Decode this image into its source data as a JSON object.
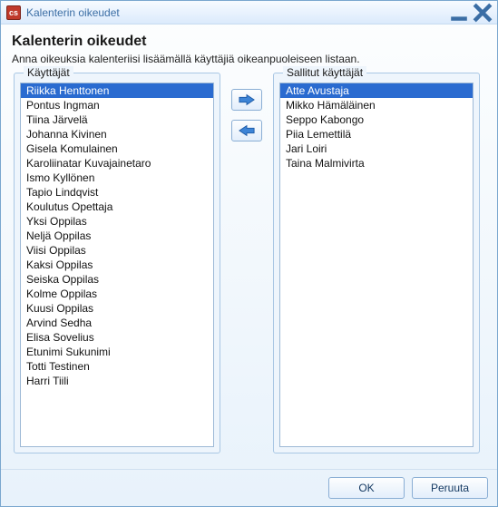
{
  "window": {
    "title": "Kalenterin oikeudet"
  },
  "dialog": {
    "title": "Kalenterin oikeudet",
    "subtitle": "Anna oikeuksia kalenteriisi lisäämällä käyttäjiä oikeanpuoleiseen listaan."
  },
  "lists": {
    "users_label": "Käyttäjät",
    "allowed_label": "Sallitut käyttäjät",
    "users": [
      {
        "name": "Riikka Henttonen",
        "selected": true
      },
      {
        "name": "Pontus Ingman"
      },
      {
        "name": "Tiina Järvelä"
      },
      {
        "name": "Johanna Kivinen"
      },
      {
        "name": "Gisela Komulainen"
      },
      {
        "name": "Karoliinatar Kuvajainetaro"
      },
      {
        "name": "Ismo Kyllönen"
      },
      {
        "name": "Tapio Lindqvist"
      },
      {
        "name": "Koulutus Opettaja"
      },
      {
        "name": "Yksi Oppilas"
      },
      {
        "name": "Neljä Oppilas"
      },
      {
        "name": "Viisi Oppilas"
      },
      {
        "name": "Kaksi Oppilas"
      },
      {
        "name": "Seiska Oppilas"
      },
      {
        "name": "Kolme Oppilas"
      },
      {
        "name": "Kuusi Oppilas"
      },
      {
        "name": "Arvind Sedha"
      },
      {
        "name": "Elisa Sovelius"
      },
      {
        "name": "Etunimi Sukunimi"
      },
      {
        "name": "Totti Testinen"
      },
      {
        "name": "Harri Tiili"
      }
    ],
    "allowed": [
      {
        "name": "Atte Avustaja",
        "selected": true
      },
      {
        "name": "Mikko Hämäläinen"
      },
      {
        "name": "Seppo Kabongo"
      },
      {
        "name": "Piia Lemettilä"
      },
      {
        "name": "Jari Loiri"
      },
      {
        "name": "Taina Malmivirta"
      }
    ]
  },
  "buttons": {
    "ok": "OK",
    "cancel": "Peruuta"
  }
}
